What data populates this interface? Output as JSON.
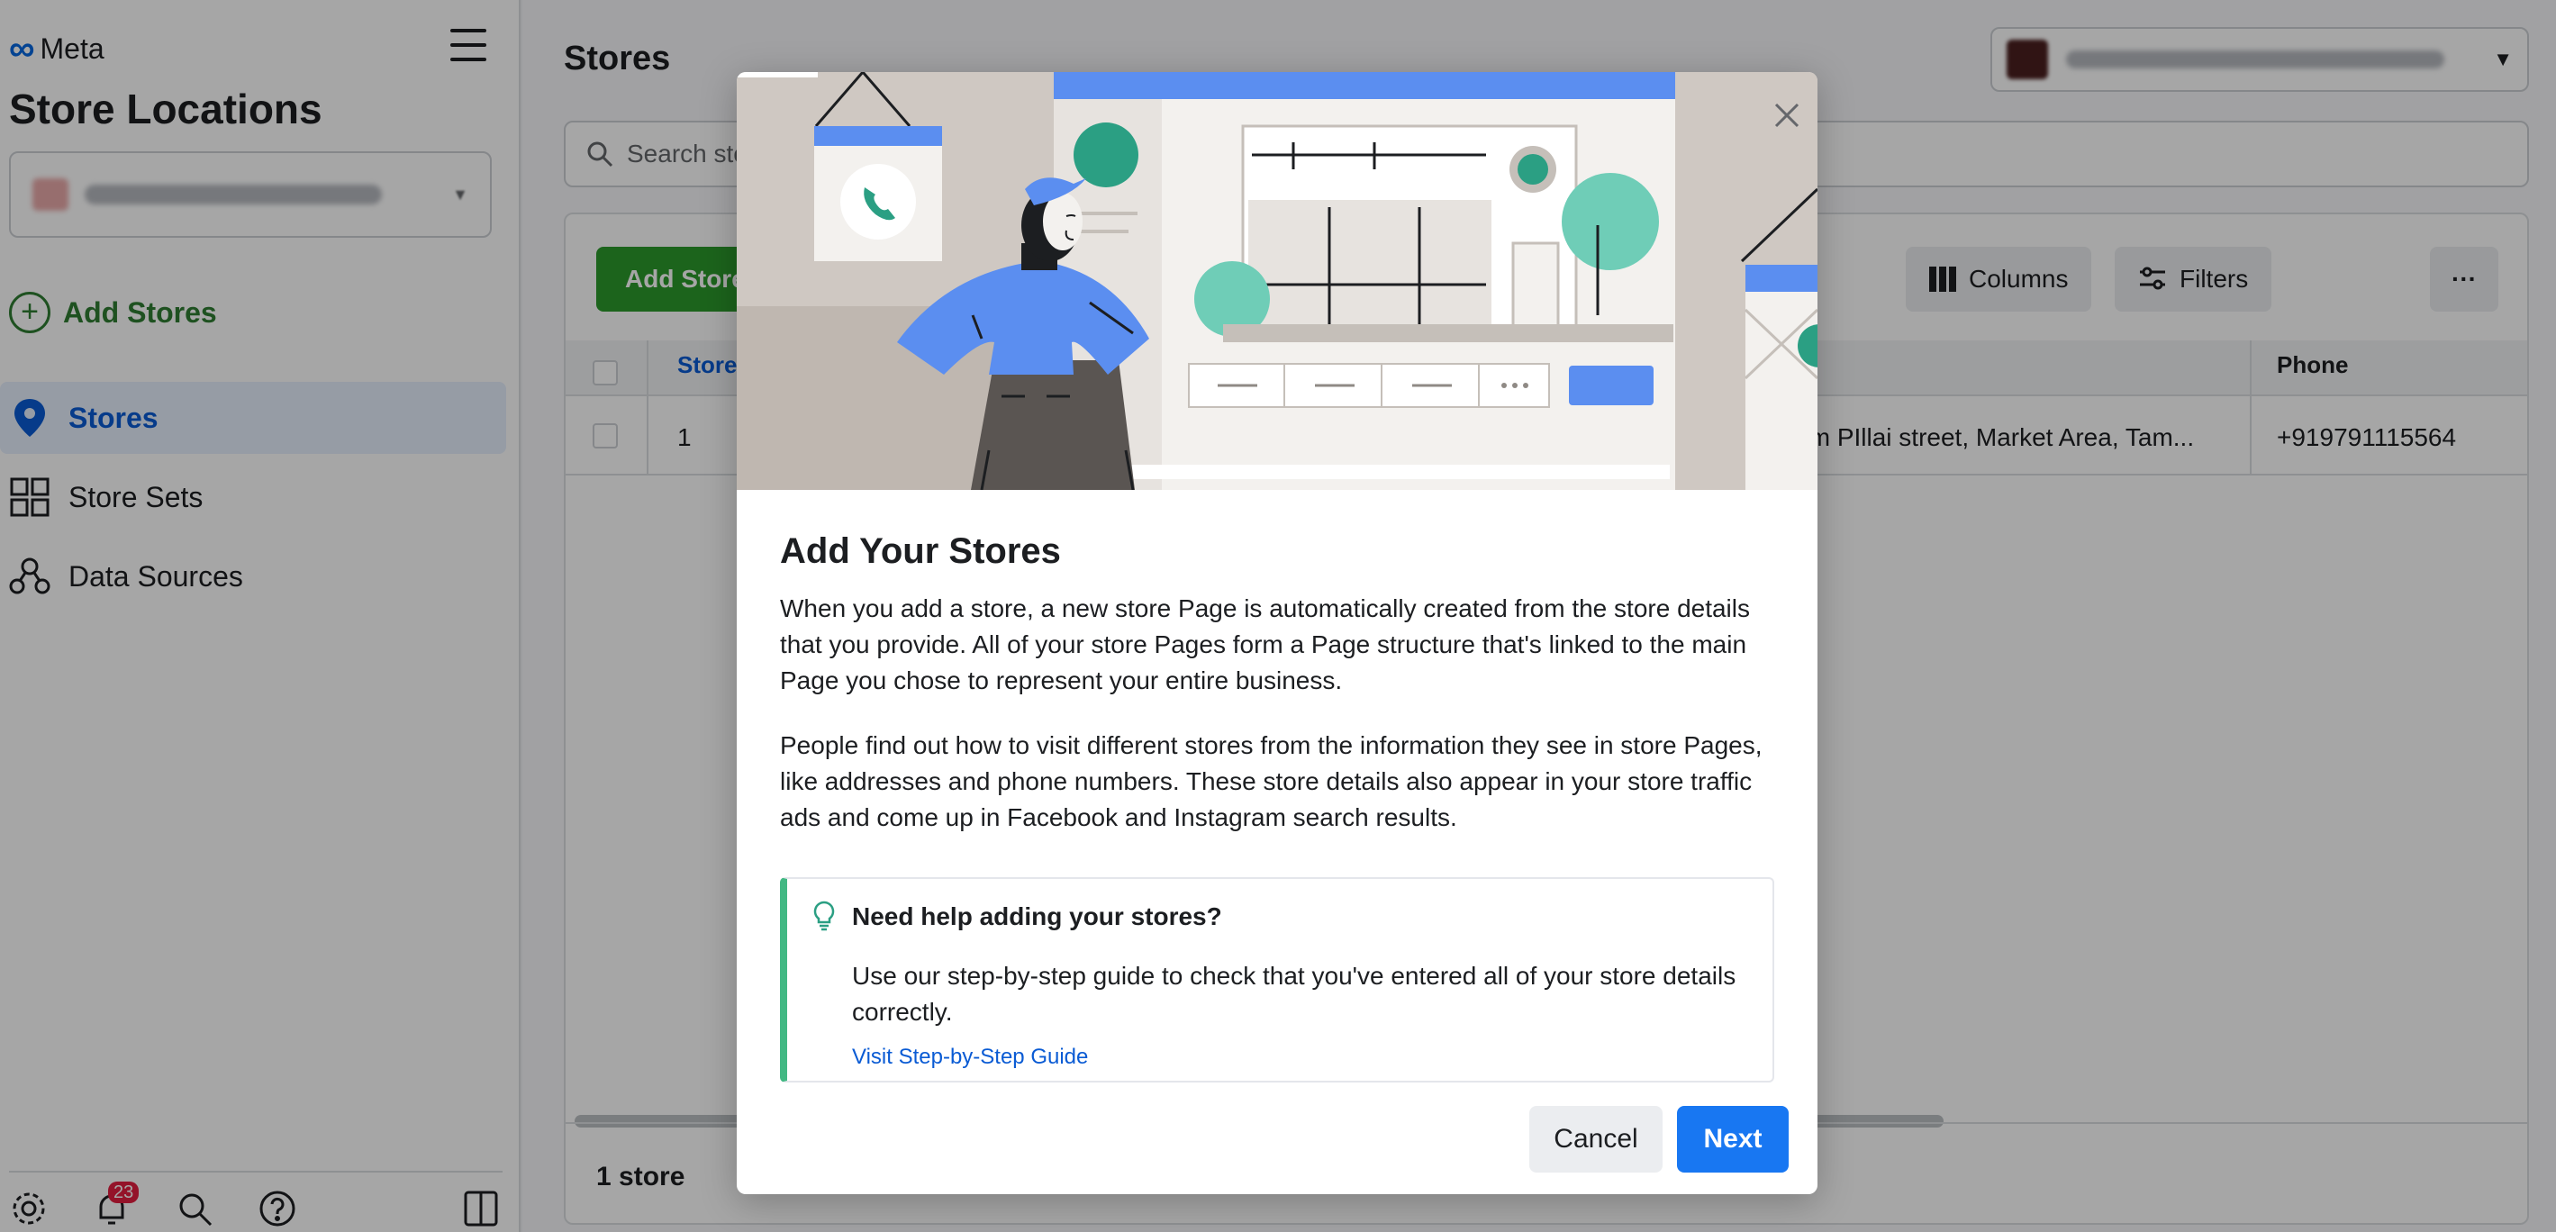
{
  "brand": {
    "name": "Meta"
  },
  "sidebar": {
    "app_title": "Store Locations",
    "add_stores": "Add Stores",
    "items": [
      {
        "label": "Stores",
        "icon": "location-pin-icon",
        "active": true
      },
      {
        "label": "Store Sets",
        "icon": "grid-icon",
        "active": false
      },
      {
        "label": "Data Sources",
        "icon": "data-sources-icon",
        "active": false
      }
    ],
    "footer": {
      "notification_count": "23"
    }
  },
  "main": {
    "title": "Stores",
    "search": {
      "placeholder": "Search stores"
    },
    "toolbar": {
      "add_stores": "Add Stores",
      "columns": "Columns",
      "filters": "Filters",
      "more": "···"
    },
    "table": {
      "headers": {
        "store": "Store",
        "phone": "Phone"
      },
      "rows": [
        {
          "store": "1",
          "address": "ugam PIllai street, Market Area, Tam...",
          "phone": "+919791115564"
        }
      ]
    },
    "footer": {
      "count": "1 store"
    }
  },
  "modal": {
    "title": "Add Your Stores",
    "para1": "When you add a store, a new store Page is automatically created from the store details that you provide. All of your store Pages form a Page structure that's linked to the main Page you chose to represent your entire business.",
    "para2": "People find out how to visit different stores from the information they see in store Pages, like addresses and phone numbers. These store details also appear in your store traffic ads and come up in Facebook and Instagram search results.",
    "tip": {
      "title": "Need help adding your stores?",
      "body": "Use our step-by-step guide to check that you've entered all of your store details correctly.",
      "link": "Visit Step-by-Step Guide"
    },
    "cancel": "Cancel",
    "next": "Next"
  },
  "colors": {
    "accent": "#1877f2",
    "brand_green": "#2c9a2c",
    "tip_border": "#42b883",
    "active_nav": "#0a5bd4"
  }
}
